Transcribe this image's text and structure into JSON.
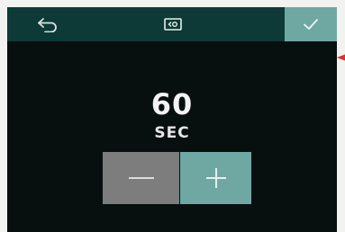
{
  "topbar": {
    "back_icon": "back-arrow-icon",
    "display_icon": "display-mode-icon",
    "confirm_icon": "check-icon"
  },
  "setting": {
    "value": "60",
    "unit": "SEC"
  },
  "controls": {
    "decrease_icon": "minus-icon",
    "increase_icon": "plus-icon"
  },
  "colors": {
    "screen_bg": "#07100f",
    "topbar_bg": "#0d3a36",
    "accent": "#6fa8a3",
    "neutral_button": "#7d7d7d",
    "marker": "#e0302a"
  }
}
